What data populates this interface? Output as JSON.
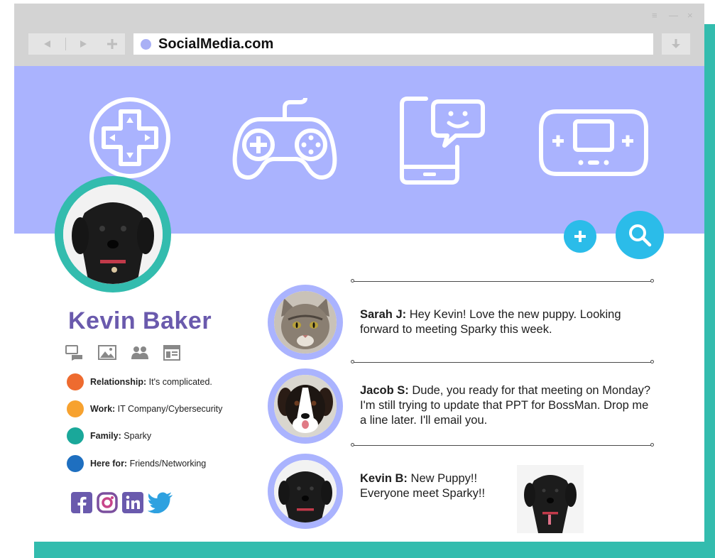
{
  "browser": {
    "url": "SocialMedia.com",
    "window_controls": [
      "≡",
      "—",
      "×"
    ]
  },
  "banner": {
    "icons": [
      "dpad-icon",
      "gamepad-icon",
      "phone-chat-icon",
      "handheld-console-icon"
    ]
  },
  "actions": {
    "add_icon": "plus-icon",
    "search_icon": "search-icon"
  },
  "profile": {
    "name": "Kevin Baker",
    "tabs": [
      "chat-icon",
      "photos-icon",
      "friends-icon",
      "newsfeed-icon"
    ],
    "info": [
      {
        "label": "Relationship:",
        "value": " It's complicated.",
        "color": "#ee6b2f"
      },
      {
        "label": "Work:",
        "value": " IT Company/Cybersecurity",
        "color": "#f7a22f"
      },
      {
        "label": "Family:",
        "value": " Sparky",
        "color": "#1aa89a"
      },
      {
        "label": "Here for:",
        "value": " Friends/Networking",
        "color": "#1e6fc0"
      }
    ],
    "socials": [
      "facebook-icon",
      "instagram-icon",
      "linkedin-icon",
      "twitter-icon"
    ]
  },
  "feed": {
    "messages": [
      {
        "author": "Sarah J:",
        "text": " Hey Kevin! Love the new puppy. Looking forward to meeting Sparky this week.",
        "avatar": "cat-avatar"
      },
      {
        "author": "Jacob S:",
        "text": " Dude, you ready for that meeting on Monday? I'm still trying to update that PPT for BossMan. Drop me a line later. I'll email you.",
        "avatar": "dog-avatar"
      },
      {
        "author": "Kevin B:",
        "text": " New Puppy!! Everyone meet Sparky!!",
        "avatar": "puppy-avatar"
      }
    ]
  },
  "colors": {
    "banner": "#aab3fe",
    "teal": "#33bcae",
    "accent_blue": "#2bbce9",
    "name": "#6a5aad"
  }
}
